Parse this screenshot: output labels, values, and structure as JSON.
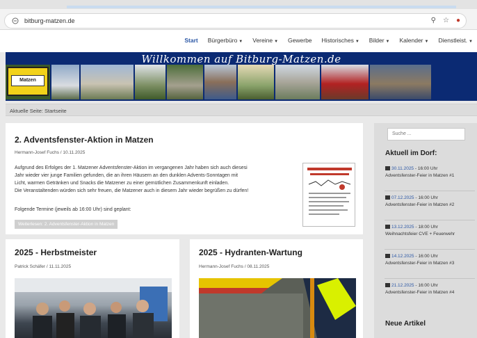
{
  "browser": {
    "url": "bitburg-matzen.de"
  },
  "nav": {
    "items": [
      {
        "label": "Start",
        "active": true,
        "dropdown": false
      },
      {
        "label": "Bürgerbüro",
        "dropdown": true
      },
      {
        "label": "Vereine",
        "dropdown": true
      },
      {
        "label": "Gewerbe",
        "dropdown": false
      },
      {
        "label": "Historisches",
        "dropdown": true
      },
      {
        "label": "Bilder",
        "dropdown": true
      },
      {
        "label": "Kalender",
        "dropdown": true
      },
      {
        "label": "Dienstleist.",
        "dropdown": true
      }
    ]
  },
  "banner": {
    "title": "Willkommen auf Bitburg-Matzen.de",
    "sign_text": "Matzen"
  },
  "breadcrumb": {
    "text": "Aktuelle Seite: Startseite"
  },
  "article_main": {
    "title": "2. Adventsfenster-Aktion in Matzen",
    "meta": "Hermann-Josef Fuchs / 10.11.2025",
    "body": [
      "Aufgrund des Erfolges der 1. Matzener Adventsfenster-Aktion im vergangenen Jahr haben sich auch diesesi",
      "Jahr wieder vier junge Familien gefunden, die an ihren Häusern an den dunklen Advents-Sonntagen mit",
      "Licht, warmen Getränken und Snacks die Matzener zu einer gemütlichen Zusammenkunft einladen.",
      "Die Veranstaltenden würden sich sehr freuen, die Matzener auch in diesem Jahr wieder begrüßen zu dürfen!"
    ],
    "dates_line": "Folgende Termine (jeweils ab 16:00 Uhr) sind geplant:",
    "button": "Weiterlesen: 2. Adventsfenster-Aktion in Matzen"
  },
  "article_left": {
    "title": "2025 - Herbstmeister",
    "meta": "Patrick Schäfer / 11.11.2025"
  },
  "article_right": {
    "title": "2025 - Hydranten-Wartung",
    "meta": "Hermann-Josef Fuchs / 08.11.2025"
  },
  "sidebar": {
    "search_placeholder": "Suche ...",
    "heading_events": "Aktuell im Dorf:",
    "events": [
      {
        "date": "30.11.2025",
        "time": " - 16:00 Uhr",
        "text": "Adventsfenster-Feier in Matzen #1"
      },
      {
        "date": "07.12.2025",
        "time": " - 16:00 Uhr",
        "text": "Adventsfenster-Feier in Matzen #2"
      },
      {
        "date": "13.12.2025",
        "time": " - 18:00 Uhr",
        "text": "Weihnachtsfeier CVE + Feuerwehr"
      },
      {
        "date": "14.12.2025",
        "time": " - 16:00 Uhr",
        "text": "Adventsfenster-Feier in Matzen #3"
      },
      {
        "date": "21.12.2025",
        "time": " - 16:00 Uhr",
        "text": "Adventsfenster-Feier in Matzen #4"
      }
    ],
    "heading_new": "Neue Artikel"
  },
  "colors": {
    "banner_bg": "#0b2a73",
    "link": "#2b57a5",
    "page_bg": "#e9e9e9"
  }
}
